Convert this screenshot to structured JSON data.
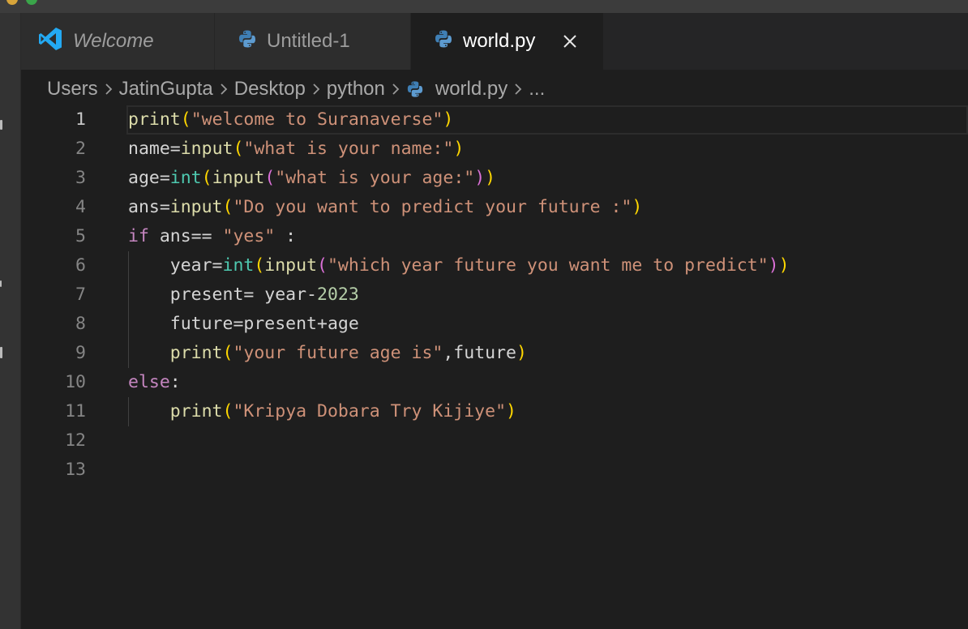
{
  "tabs": [
    {
      "label": "Welcome",
      "icon": "vscode-logo-icon",
      "active": false,
      "italic": true
    },
    {
      "label": "Untitled-1",
      "icon": "python-icon",
      "active": false,
      "italic": false
    },
    {
      "label": "world.py",
      "icon": "python-icon",
      "active": true,
      "italic": false,
      "close": "×"
    }
  ],
  "breadcrumb": {
    "items": [
      "Users",
      "JatinGupta",
      "Desktop",
      "python",
      "world.py",
      "..."
    ]
  },
  "editor": {
    "line_numbers": [
      "1",
      "2",
      "3",
      "4",
      "5",
      "6",
      "7",
      "8",
      "9",
      "10",
      "11",
      "12",
      "13"
    ],
    "active_line": 1,
    "lines": [
      "print(\"welcome to Suranaverse\")",
      "name=input(\"what is your name:\")",
      "age=int(input(\"what is your age:\"))",
      "ans=input(\"Do you want to predict your future :\")",
      "if ans== \"yes\" :",
      "    year=int(input(\"which year future you want me to predict\"))",
      "    present= year-2023",
      "    future=present+age",
      "    print(\"your future age is\",future)",
      "else:",
      "    print(\"Kripya Dobara Try Kijiye\")",
      "",
      ""
    ]
  },
  "colors": {
    "background": "#1e1e1e",
    "keyword": "#c586c0",
    "function": "#dcdcaa",
    "builtin_type": "#4ec9b0",
    "string": "#ce9178",
    "number": "#b5cea8",
    "bracket_level1": "#ffd700",
    "bracket_level2": "#da70d6",
    "bracket_level3": "#179fff",
    "vscode_blue": "#23a9f2",
    "python_blue": "#3776ab",
    "python_yellow": "#ffd43b"
  }
}
